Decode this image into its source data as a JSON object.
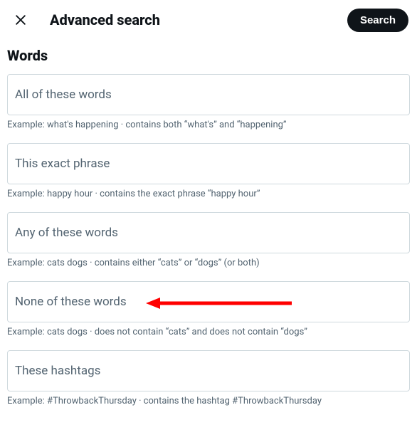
{
  "header": {
    "title": "Advanced search",
    "search_button": "Search"
  },
  "section": {
    "title": "Words"
  },
  "fields": [
    {
      "label": "All of these words",
      "help": "Example: what's happening · contains both “what's” and “happening”"
    },
    {
      "label": "This exact phrase",
      "help": "Example: happy hour · contains the exact phrase “happy hour”"
    },
    {
      "label": "Any of these words",
      "help": "Example: cats dogs · contains either “cats” or “dogs” (or both)"
    },
    {
      "label": "None of these words",
      "help": "Example: cats dogs · does not contain “cats” and does not contain “dogs”"
    },
    {
      "label": "These hashtags",
      "help": "Example: #ThrowbackThursday · contains the hashtag #ThrowbackThursday"
    }
  ],
  "annotation": {
    "arrow_target_index": 3,
    "color": "#ff0000"
  }
}
